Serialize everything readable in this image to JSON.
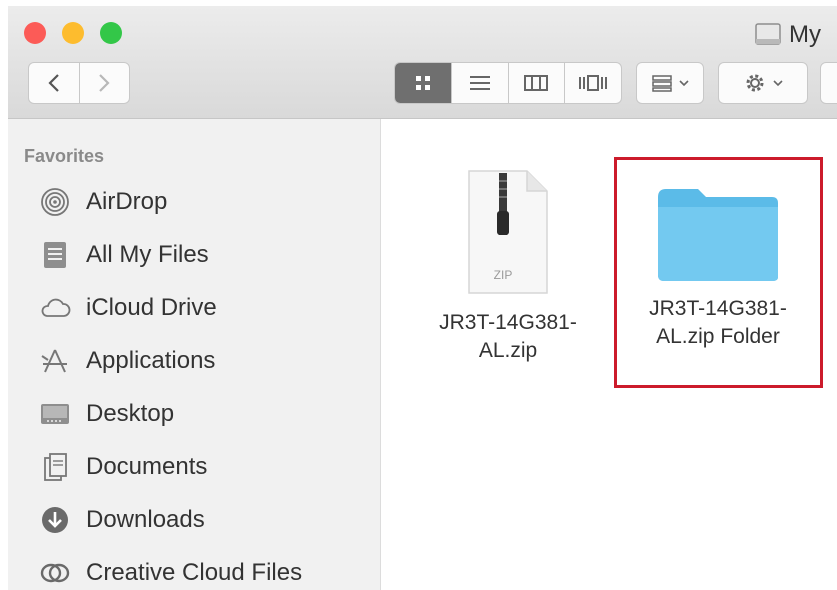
{
  "window": {
    "title": "My",
    "traffic_lights": {
      "close": "#fc5b57",
      "minimize": "#fdbc2e",
      "maximize": "#33c748"
    }
  },
  "toolbar": {
    "nav": [
      "back",
      "forward"
    ],
    "views": [
      "icon-view",
      "list-view",
      "column-view",
      "cover-flow-view"
    ],
    "active_view": "icon-view"
  },
  "sidebar": {
    "section_title": "Favorites",
    "items": [
      {
        "label": "AirDrop",
        "icon": "airdrop-icon"
      },
      {
        "label": "All My Files",
        "icon": "all-my-files-icon"
      },
      {
        "label": "iCloud Drive",
        "icon": "icloud-icon"
      },
      {
        "label": "Applications",
        "icon": "applications-icon"
      },
      {
        "label": "Desktop",
        "icon": "desktop-icon"
      },
      {
        "label": "Documents",
        "icon": "documents-icon"
      },
      {
        "label": "Downloads",
        "icon": "downloads-icon"
      },
      {
        "label": "Creative Cloud Files",
        "icon": "creative-cloud-icon"
      }
    ]
  },
  "files": [
    {
      "name_line1": "JR3T-14G381-",
      "name_line2": "AL.zip",
      "type_label": "ZIP",
      "kind": "zip"
    },
    {
      "name_line1": "JR3T-14G381-",
      "name_line2": "AL.zip Folder",
      "kind": "folder",
      "highlighted": true
    }
  ],
  "colors": {
    "highlight": "#cc1b2b",
    "folder": "#5bbbe8"
  }
}
